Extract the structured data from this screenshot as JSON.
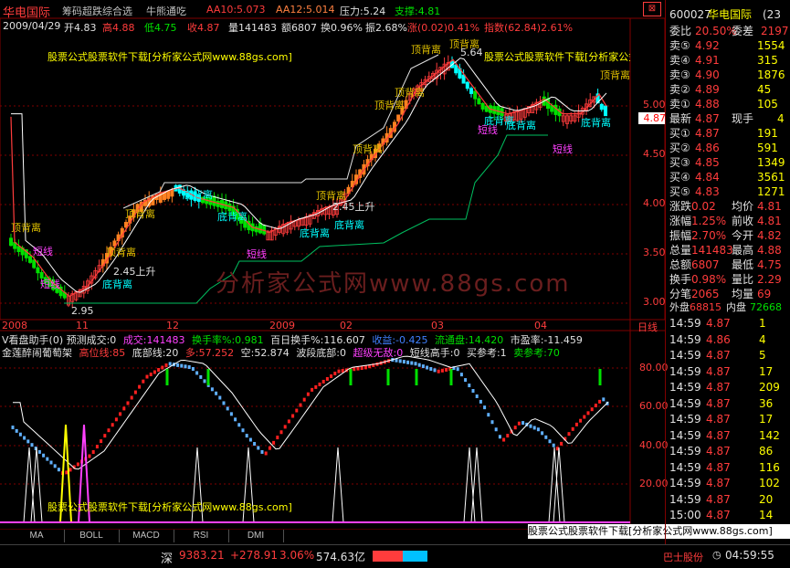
{
  "header": {
    "stock_name": "华电国际",
    "indicator_name": "筹码超跌综合选",
    "mode_name": "牛熊通吃",
    "aa10": "AA10:5.073",
    "aa12": "AA12:5.014",
    "pressure": "压力:5.24",
    "support": "支撑:4.81",
    "date": "2009/04/29",
    "open": "开4.83",
    "high": "高4.88",
    "low": "低4.75",
    "close": "收4.87",
    "volume": "量141483",
    "amount": "额6807",
    "turnover": "换0.96%",
    "amplitude": "振2.68%",
    "change": "涨(0.02)0.41%",
    "index": "指数(62.84)2.61%"
  },
  "main_chart": {
    "watermark": "股票公式股票软件下载[分析家公式网www.88gs.com]",
    "watermark2": "股票公式股票软件下载[分析家公式网www.88gs.com]",
    "big_watermark": "分析家公式网www.88gs.com",
    "price_ticks": [
      "5.00",
      "4.50",
      "4.00",
      "3.50",
      "3.00"
    ],
    "annotations": {
      "top": "顶背离",
      "bottom": "底背离",
      "short": "短线",
      "rise": "2.45上升",
      "low_price": "2.95",
      "high_price": "5.64"
    },
    "x_labels": [
      "2008",
      "11",
      "12",
      "2009",
      "02",
      "03",
      "04"
    ],
    "period": "日线"
  },
  "sub_chart": {
    "line1": "V看盘助手(0)  预测成交:0",
    "volume": "成交:141483",
    "turn_rate": "换手率%:0.981",
    "day100": "百日换手%:116.607",
    "income": "收益:-0.425",
    "float": "流通盘:14.420",
    "pe": "市盈率:-11.459",
    "line2": "金莲醉闹葡萄架",
    "hi_pos": "高位线:85",
    "bottom_line": "底部线:20",
    "duo": "多:57.252",
    "kong": "空:52.874",
    "wave": "波段底部:0",
    "super_low": "超级无敌:0",
    "short_master": "短线高手:0",
    "buy_ref": "买参考:1",
    "sell_ref": "卖参考:70",
    "ticks": [
      "80.00",
      "60.00",
      "40.00",
      "20.00"
    ],
    "watermark": "股票公式股票软件下载[分析家公式网www.88gs.com]"
  },
  "tabs": [
    "MA",
    "BOLL",
    "MACD",
    "RSI",
    "DMI"
  ],
  "right_panel": {
    "code": "600027",
    "name": "华电国际",
    "suffix": "(23",
    "ratio_label": "委比",
    "ratio": "20.50%",
    "diff_label": "委差",
    "diff": "2197",
    "asks": [
      {
        "label": "卖⑤",
        "price": "4.92",
        "vol": "1554"
      },
      {
        "label": "卖④",
        "price": "4.91",
        "vol": "315"
      },
      {
        "label": "卖③",
        "price": "4.90",
        "vol": "1876"
      },
      {
        "label": "卖②",
        "price": "4.89",
        "vol": "45"
      },
      {
        "label": "卖①",
        "price": "4.88",
        "vol": "105"
      }
    ],
    "last_label": "最新",
    "last_price": "4.87",
    "cur_label": "现手",
    "cur_vol": "4",
    "bids": [
      {
        "label": "买①",
        "price": "4.87",
        "vol": "191"
      },
      {
        "label": "买②",
        "price": "4.86",
        "vol": "591"
      },
      {
        "label": "买③",
        "price": "4.85",
        "vol": "1349"
      },
      {
        "label": "买④",
        "price": "4.84",
        "vol": "3561"
      },
      {
        "label": "买⑤",
        "price": "4.83",
        "vol": "1271"
      }
    ],
    "stats": [
      {
        "l1": "涨跌",
        "v1": "0.02",
        "l2": "均价",
        "v2": "4.81"
      },
      {
        "l1": "涨幅",
        "v1": "1.25%",
        "l2": "前收",
        "v2": "4.81"
      },
      {
        "l1": "振幅",
        "v1": "2.70%",
        "l2": "今开",
        "v2": "4.82"
      },
      {
        "l1": "总量",
        "v1": "141483",
        "l2": "最高",
        "v2": "4.88"
      },
      {
        "l1": "总额",
        "v1": "6807",
        "l2": "最低",
        "v2": "4.75"
      },
      {
        "l1": "换手",
        "v1": "0.98%",
        "l2": "量比",
        "v2": "2.29"
      },
      {
        "l1": "分笔",
        "v1": "2065",
        "l2": "均量",
        "v2": "69"
      }
    ],
    "outer_label": "外盘",
    "outer": "68815",
    "inner_label": "内盘",
    "inner": "72668",
    "ticks": [
      {
        "time": "14:59",
        "price": "4.87",
        "vol": "1"
      },
      {
        "time": "14:59",
        "price": "4.86",
        "vol": "4"
      },
      {
        "time": "14:59",
        "price": "4.87",
        "vol": "5"
      },
      {
        "time": "14:59",
        "price": "4.87",
        "vol": "17"
      },
      {
        "time": "14:59",
        "price": "4.87",
        "vol": "209"
      },
      {
        "time": "14:59",
        "price": "4.87",
        "vol": "36"
      },
      {
        "time": "14:59",
        "price": "4.87",
        "vol": "17"
      },
      {
        "time": "14:59",
        "price": "4.87",
        "vol": "142"
      },
      {
        "time": "14:59",
        "price": "4.87",
        "vol": "86"
      },
      {
        "time": "14:59",
        "price": "4.87",
        "vol": "116"
      },
      {
        "time": "14:59",
        "price": "4.87",
        "vol": "102"
      },
      {
        "time": "14:59",
        "price": "4.87",
        "vol": "20"
      },
      {
        "time": "15:00",
        "price": "4.87",
        "vol": "14"
      }
    ],
    "tick_times_partial": [
      "14:59",
      "4:59",
      "4:59",
      "4:59",
      "4:59",
      "4:59",
      "4:59",
      "4:59",
      "4:59",
      "4:59"
    ]
  },
  "status": {
    "market": "深",
    "index": "9383.21",
    "change": "+278.91",
    "pct": "3.06%",
    "amount": "574.63亿",
    "ticker_text": "巴士股份",
    "time": "04:59:55"
  }
}
